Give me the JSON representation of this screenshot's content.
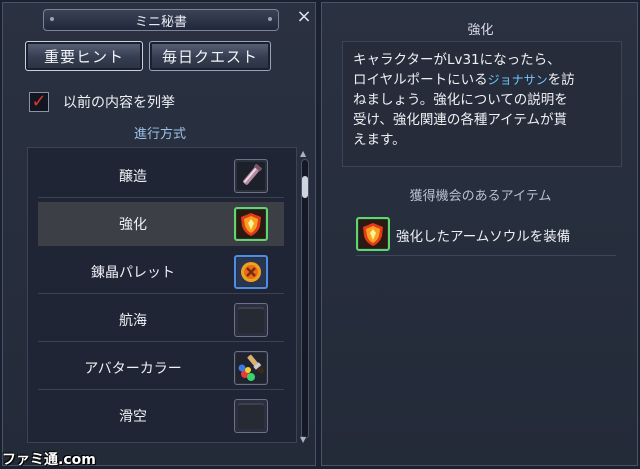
{
  "window": {
    "title": "ミニ秘書",
    "close_icon": "×"
  },
  "tabs": {
    "hint": "重要ヒント",
    "daily": "毎日クエスト"
  },
  "options": {
    "show_previous_label": "以前の内容を列挙",
    "show_previous_checked": true,
    "check_mark": "✓"
  },
  "progress": {
    "section_title": "進行方式"
  },
  "list": [
    {
      "label": "醸造",
      "icon": "potion-icon"
    },
    {
      "label": "強化",
      "icon": "shield-icon",
      "selected": true
    },
    {
      "label": "錬晶パレット",
      "icon": "crystal-icon"
    },
    {
      "label": "航海",
      "icon": "empty-slot"
    },
    {
      "label": "アバターカラー",
      "icon": "paint-brush-icon"
    },
    {
      "label": "滑空",
      "icon": "empty-slot"
    }
  ],
  "scroll": {
    "up": "▲",
    "down": "▼"
  },
  "detail": {
    "title": "強化",
    "description": {
      "line1": "キャラクターがLv31になったら、",
      "line2_pre": "ロイヤルポートにいる",
      "line2_npc": "ジョナサン",
      "line2_post": "を訪",
      "line3": "ねましょう。強化についての説明を",
      "line4": "受け、強化関連の各種アイテムが貰",
      "line5": "えます。"
    },
    "reward_title": "獲得機会のあるアイテム",
    "reward_label": "強化したアームソウルを装備",
    "reward_icon": "shield-icon"
  },
  "watermark": "ファミ通.com",
  "colors": {
    "accent_blue": "#6ec6ff",
    "checkbox_red": "#e0322e",
    "selected_green": "#5fd86a",
    "selected_blue": "#4a8fe4"
  }
}
